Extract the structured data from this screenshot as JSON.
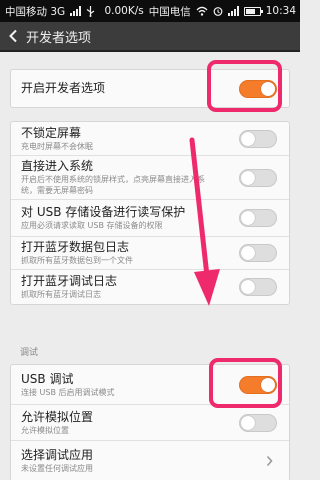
{
  "status_bar": {
    "carrier": "中国移动 3G",
    "speed": "0.00K/s",
    "carrier2": "中国电信",
    "time": "10:34",
    "icons": [
      "signal-icon",
      "usb-icon",
      "wifi-icon",
      "alarm-icon",
      "signal-icon",
      "battery-icon"
    ]
  },
  "title_bar": {
    "back_icon": "back-arrow-icon",
    "title": "开发者选项"
  },
  "master": {
    "label": "开启开发者选项",
    "on": true
  },
  "group1": [
    {
      "title": "不锁定屏幕",
      "subtitle": [
        "充电时屏幕不会休眠"
      ],
      "on": false
    },
    {
      "title": "直接进入系统",
      "subtitle": [
        "开启后不使用系统的锁屏样式，点亮屏幕直接进入系",
        "统，需要无屏幕密码"
      ],
      "on": false
    },
    {
      "title": "对 USB 存储设备进行读写保护",
      "subtitle": [
        "应用必须请求读取 USB 存储设备的权限"
      ],
      "on": false
    },
    {
      "title": "打开蓝牙数据包日志",
      "subtitle": [
        "抓取所有蓝牙数据包到一个文件"
      ],
      "on": false
    },
    {
      "title": "打开蓝牙调试日志",
      "subtitle": [
        "抓取所有蓝牙调试日志"
      ],
      "on": false
    }
  ],
  "section_debug": "调试",
  "group2": [
    {
      "title": "USB 调试",
      "subtitle": [
        "连接 USB 后启用调试模式"
      ],
      "on": true,
      "kind": "toggle"
    },
    {
      "title": "允许模拟位置",
      "subtitle": [
        "允许模拟位置"
      ],
      "on": false,
      "kind": "toggle"
    },
    {
      "title": "选择调试应用",
      "subtitle": [
        "未设置任何调试应用"
      ],
      "kind": "chevron",
      "chevron_icon": "chevron-right-icon"
    }
  ],
  "colors": {
    "toggle_on": "#f47c2a",
    "highlight": "#ee2a6d",
    "title_bar": "#3c3c3c"
  }
}
